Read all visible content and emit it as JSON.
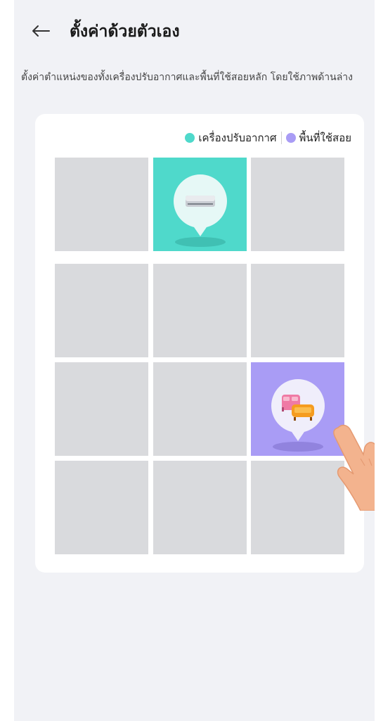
{
  "header": {
    "back_icon": "arrow-left-icon",
    "title": "ตั้งค่าด้วยตัวเอง"
  },
  "description": "ตั้งค่าตำแหน่งของทั้งเครื่องปรับอากาศและพื้นที่ใช้สอยหลัก โดยใช้ภาพด้านล่าง",
  "legend": {
    "ac_label": "เครื่องปรับอากาศ",
    "ac_color": "#4fd9cb",
    "area_label": "พื้นที่ใช้สอย",
    "area_color": "#a99cf5"
  },
  "grid": {
    "rows": 4,
    "cols": 3,
    "cells": [
      {
        "row": 0,
        "col": 0,
        "state": "empty"
      },
      {
        "row": 0,
        "col": 1,
        "state": "air-conditioner",
        "icon": "air-conditioner-icon"
      },
      {
        "row": 0,
        "col": 2,
        "state": "empty"
      },
      {
        "row": 1,
        "col": 0,
        "state": "empty"
      },
      {
        "row": 1,
        "col": 1,
        "state": "empty"
      },
      {
        "row": 1,
        "col": 2,
        "state": "empty"
      },
      {
        "row": 2,
        "col": 0,
        "state": "empty"
      },
      {
        "row": 2,
        "col": 1,
        "state": "empty"
      },
      {
        "row": 2,
        "col": 2,
        "state": "living-area",
        "icon": "sofa-bed-icon"
      },
      {
        "row": 3,
        "col": 0,
        "state": "empty"
      },
      {
        "row": 3,
        "col": 1,
        "state": "empty"
      },
      {
        "row": 3,
        "col": 2,
        "state": "empty"
      }
    ]
  },
  "hint_icon": "hand-pointer-icon"
}
